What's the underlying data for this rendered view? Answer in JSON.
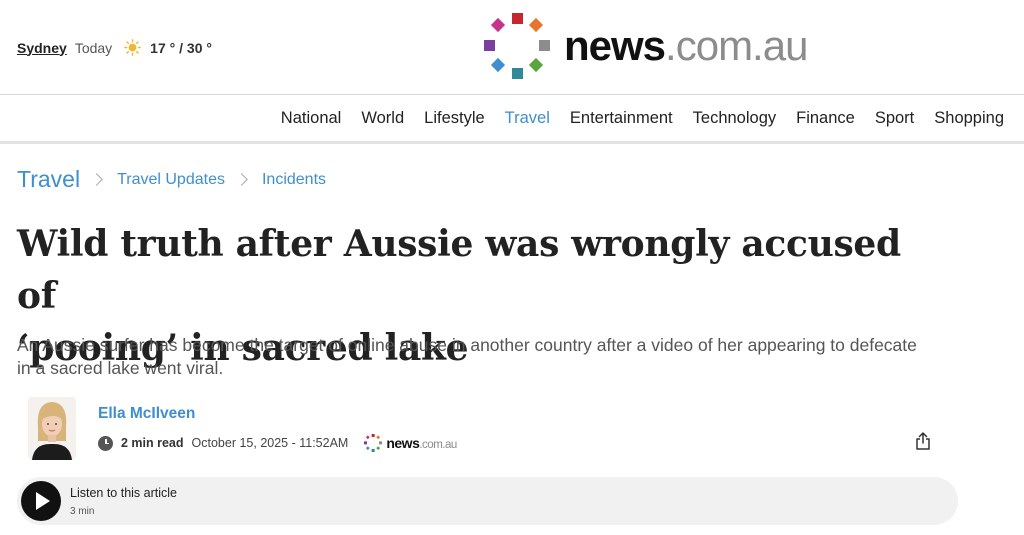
{
  "weather": {
    "city": "Sydney",
    "day": "Today",
    "icon": "sun-icon",
    "temp": "17 ° / 30 °"
  },
  "brand": {
    "name_bold": "news",
    "name_light": ".com.au",
    "colors": [
      "#c4272f",
      "#e6752f",
      "#8c8c8c",
      "#5aa540",
      "#2f8a95",
      "#3f8ecf",
      "#7b3fa0",
      "#c7338a"
    ]
  },
  "nav": {
    "items": [
      "National",
      "World",
      "Lifestyle",
      "Travel",
      "Entertainment",
      "Technology",
      "Finance",
      "Sport",
      "Shopping"
    ],
    "active": "Travel",
    "accent": "#3f8ecf"
  },
  "breadcrumb": {
    "root": "Travel",
    "items": [
      "Travel Updates",
      "Incidents"
    ]
  },
  "article": {
    "headline_line1": "Wild truth after Aussie was wrongly accused of",
    "headline_line2": "‘pooing’ in sacred lake",
    "standfirst": "An Aussie surfer has become the target of online abuse in another country after a video of her appearing to defecate in a sacred lake went viral.",
    "author": "Ella McIlveen",
    "read_time": "2 min read",
    "date": "October 15, 2025 - 11:52AM",
    "source_bold": "news",
    "source_light": ".com.au"
  },
  "listen": {
    "label": "Listen to this article",
    "duration": "3 min"
  }
}
